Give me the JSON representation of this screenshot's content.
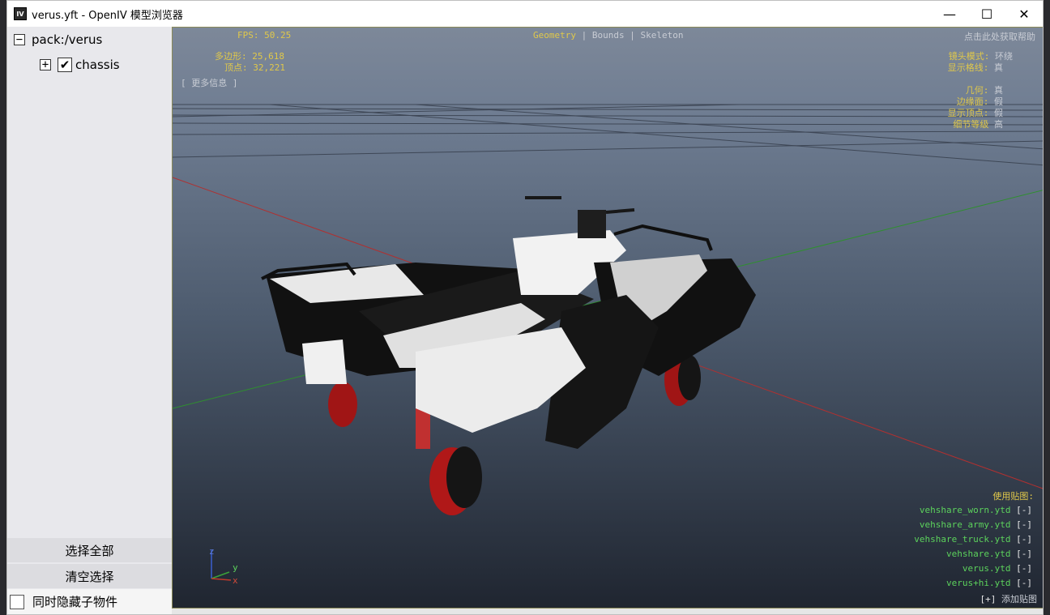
{
  "window": {
    "title": "verus.yft - OpenIV 模型浏览器",
    "icon_label": "IV",
    "minimize_glyph": "—",
    "maximize_glyph": "☐",
    "close_glyph": "✕"
  },
  "tree": {
    "root_toggle": "−",
    "root_label": "pack:/verus",
    "child_toggle": "+",
    "child_check": "✔",
    "child_label": "chassis"
  },
  "sidebar": {
    "select_all": "选择全部",
    "clear_selection": "清空选择",
    "hide_children": "同时隐藏子物件"
  },
  "hud": {
    "fps_label": "FPS:",
    "fps_value": "50.25",
    "polygons_label": "多边形:",
    "polygons_value": "25,618",
    "vertices_label": "顶点:",
    "vertices_value": "32,221",
    "more_info": "[ 更多信息 ]",
    "mode_geometry": "Geometry",
    "mode_sep1": "|",
    "mode_bounds": "Bounds",
    "mode_sep2": "|",
    "mode_skeleton": "Skeleton",
    "help": "点击此处获取帮助",
    "camera_mode_label": "镜头模式:",
    "camera_mode_value": "环绕",
    "show_grid_label": "显示格线:",
    "show_grid_value": "真",
    "geometry_label": "几何:",
    "geometry_value": "真",
    "edges_label": "边缘面:",
    "edges_value": "假",
    "show_vertices_label": "显示顶点:",
    "show_vertices_value": "假",
    "lod_label": "细节等级",
    "lod_value": "高",
    "textures_title": "使用贴图:",
    "textures": [
      {
        "name": "vehshare_worn.ytd",
        "action": "[-]"
      },
      {
        "name": "vehshare_army.ytd",
        "action": "[-]"
      },
      {
        "name": "vehshare_truck.ytd",
        "action": "[-]"
      },
      {
        "name": "vehshare.ytd",
        "action": "[-]"
      },
      {
        "name": "verus.ytd",
        "action": "[-]"
      },
      {
        "name": "verus+hi.ytd",
        "action": "[-]"
      }
    ],
    "add_texture_btn": "[+]",
    "add_texture_label": "添加贴图",
    "axis_x": "x",
    "axis_y": "y",
    "axis_z": "z"
  },
  "colors": {
    "hud_yellow": "#e0c84a",
    "hud_green": "#5cd25c",
    "axis_red": "#c0392b",
    "axis_green": "#3aa13a"
  }
}
